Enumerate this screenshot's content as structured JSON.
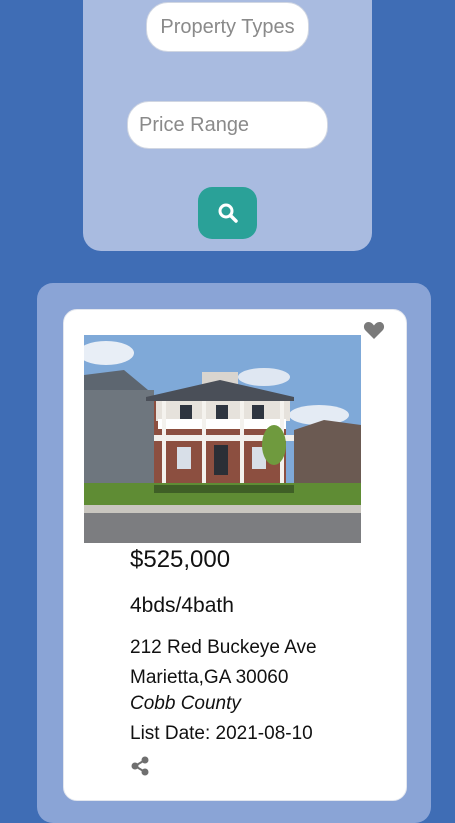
{
  "search": {
    "property_types_placeholder": "Property Types",
    "price_range_placeholder": "Price Range",
    "search_icon": "search-icon"
  },
  "listing": {
    "price": "$525,000",
    "beds_baths": "4bds/4bath",
    "street": "212 Red Buckeye Ave",
    "city_state_zip": "Marietta,GA 30060",
    "county": "Cobb County",
    "list_date": "List Date: 2021-08-10",
    "favorite_icon": "heart-icon",
    "share_icon": "share-icon"
  },
  "colors": {
    "page_bg": "#3f6db5",
    "search_panel_bg": "#a9bbe0",
    "results_panel_bg": "#8aa4d6",
    "accent": "#2aa198"
  }
}
